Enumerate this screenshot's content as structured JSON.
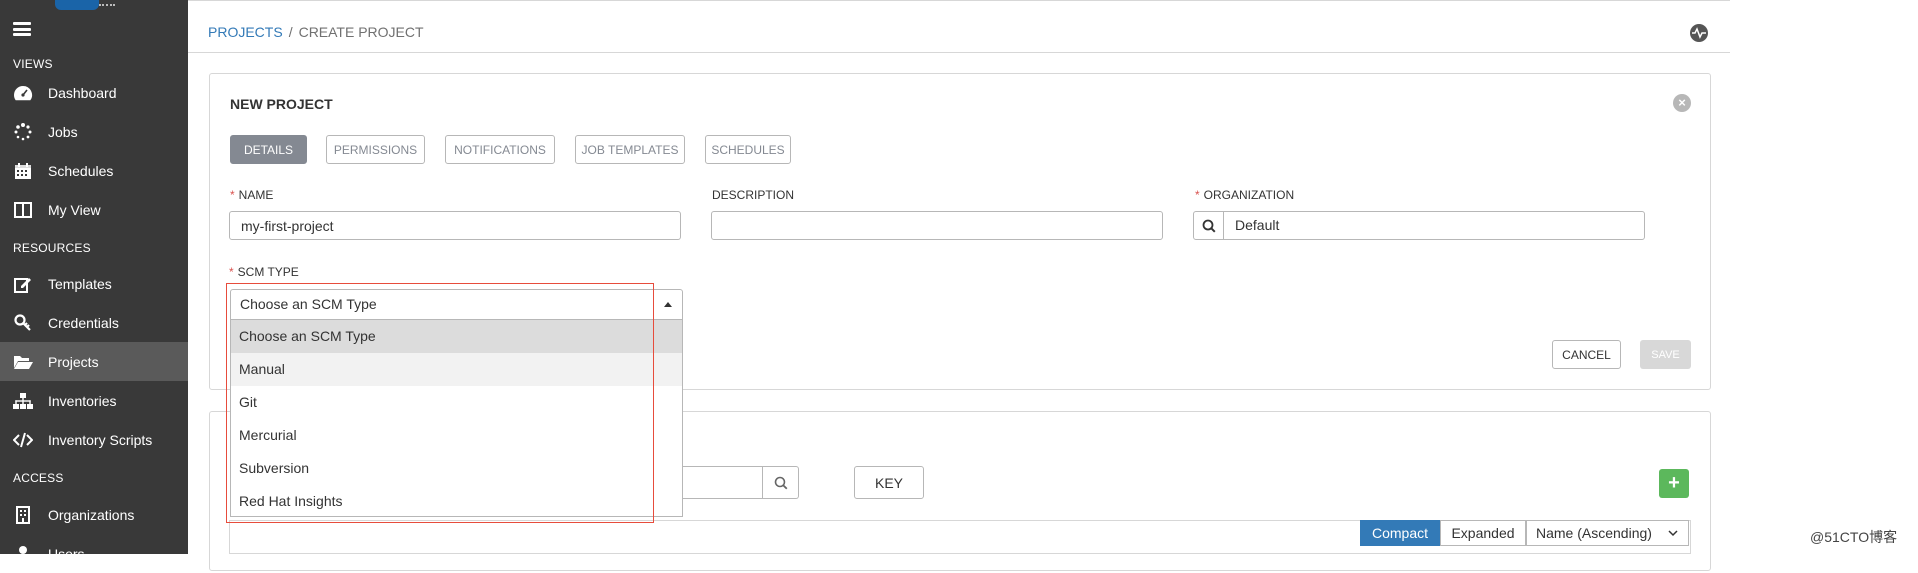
{
  "sidebar": {
    "sections": {
      "views": "VIEWS",
      "resources": "RESOURCES",
      "access": "ACCESS"
    },
    "items": [
      {
        "label": "Dashboard",
        "icon": "dashboard-icon"
      },
      {
        "label": "Jobs",
        "icon": "spinner-icon"
      },
      {
        "label": "Schedules",
        "icon": "calendar-icon"
      },
      {
        "label": "My View",
        "icon": "columns-icon"
      },
      {
        "label": "Templates",
        "icon": "edit-icon"
      },
      {
        "label": "Credentials",
        "icon": "key-icon"
      },
      {
        "label": "Projects",
        "icon": "folder-open-icon",
        "active": true
      },
      {
        "label": "Inventories",
        "icon": "sitemap-icon"
      },
      {
        "label": "Inventory Scripts",
        "icon": "code-icon"
      },
      {
        "label": "Organizations",
        "icon": "building-icon"
      },
      {
        "label": "Users",
        "icon": "user-icon"
      }
    ]
  },
  "breadcrumb": {
    "projects": "PROJECTS",
    "separator": "/",
    "current": "CREATE PROJECT"
  },
  "form": {
    "title": "NEW PROJECT",
    "tabs": [
      "DETAILS",
      "PERMISSIONS",
      "NOTIFICATIONS",
      "JOB TEMPLATES",
      "SCHEDULES"
    ],
    "active_tab": "DETAILS",
    "required_mark": "*",
    "name_label": "NAME",
    "name_value": "my-first-project",
    "description_label": "DESCRIPTION",
    "description_value": "",
    "organization_label": "ORGANIZATION",
    "organization_value": "Default",
    "scm_type_label": "SCM TYPE",
    "scm_type_selected": "Choose an SCM Type",
    "scm_options": [
      "Choose an SCM Type",
      "Manual",
      "Git",
      "Mercurial",
      "Subversion",
      "Red Hat Insights"
    ],
    "cancel_label": "CANCEL",
    "save_label": "SAVE"
  },
  "list": {
    "key_label": "KEY",
    "add_label": "+",
    "view_compact": "Compact",
    "view_expanded": "Expanded",
    "sort_label": "Name (Ascending)"
  },
  "watermark": "@51CTO博客",
  "colors": {
    "sidebar_bg": "#393939",
    "link": "#337ab7",
    "required": "#d9534f",
    "add_button": "#5cb85c",
    "highlight_box": "#e74c3c"
  }
}
